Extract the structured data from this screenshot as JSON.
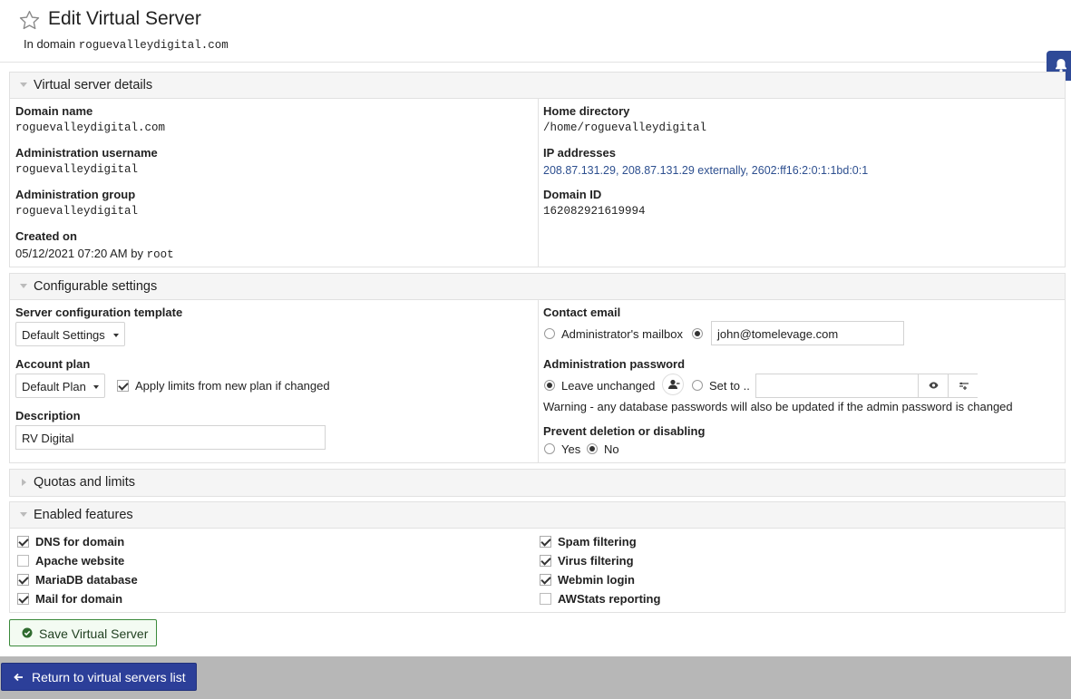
{
  "header": {
    "title": "Edit Virtual Server",
    "subtitle_prefix": "In domain",
    "subtitle_domain": "roguevalleydigital.com"
  },
  "details": {
    "section_title": "Virtual server details",
    "domain_name_label": "Domain name",
    "domain_name_value": "roguevalleydigital.com",
    "admin_user_label": "Administration username",
    "admin_user_value": "roguevalleydigital",
    "admin_group_label": "Administration group",
    "admin_group_value": "roguevalleydigital",
    "created_label": "Created on",
    "created_value": "05/12/2021 07:20 AM by",
    "created_by": "root",
    "home_dir_label": "Home directory",
    "home_dir_value": "/home/roguevalleydigital",
    "ip_label": "IP addresses",
    "ip_value": "208.87.131.29, 208.87.131.29 externally, 2602:ff16:2:0:1:1bd:0:1",
    "domain_id_label": "Domain ID",
    "domain_id_value": "162082921619994"
  },
  "config": {
    "section_title": "Configurable settings",
    "template_label": "Server configuration template",
    "template_value": "Default Settings",
    "plan_label": "Account plan",
    "plan_value": "Default Plan",
    "apply_limits_label": "Apply limits from new plan if changed",
    "apply_limits_checked": true,
    "description_label": "Description",
    "description_value": "RV Digital",
    "contact_label": "Contact email",
    "contact_opt_mailbox": "Administrator's mailbox",
    "contact_email_value": "john@tomelevage.com",
    "password_label": "Administration password",
    "password_opt_leave": "Leave unchanged",
    "password_opt_set": "Set to ..",
    "password_warning": "Warning - any database passwords will also be updated if the admin password is changed",
    "prevent_label": "Prevent deletion or disabling",
    "prevent_yes": "Yes",
    "prevent_no": "No"
  },
  "quotas": {
    "section_title": "Quotas and limits"
  },
  "features": {
    "section_title": "Enabled features",
    "left": [
      {
        "label": "DNS for domain",
        "checked": true
      },
      {
        "label": "Apache website",
        "checked": false
      },
      {
        "label": "MariaDB database",
        "checked": true
      },
      {
        "label": "Mail for domain",
        "checked": true
      }
    ],
    "right": [
      {
        "label": "Spam filtering",
        "checked": true
      },
      {
        "label": "Virus filtering",
        "checked": true
      },
      {
        "label": "Webmin login",
        "checked": true
      },
      {
        "label": "AWStats reporting",
        "checked": false
      }
    ]
  },
  "actions": {
    "save_label": "Save Virtual Server",
    "return_label": "Return to virtual servers list"
  },
  "colors": {
    "accent_blue": "#2c3f99",
    "save_green": "#3b8a3b",
    "link_blue": "#2d4f8f"
  }
}
